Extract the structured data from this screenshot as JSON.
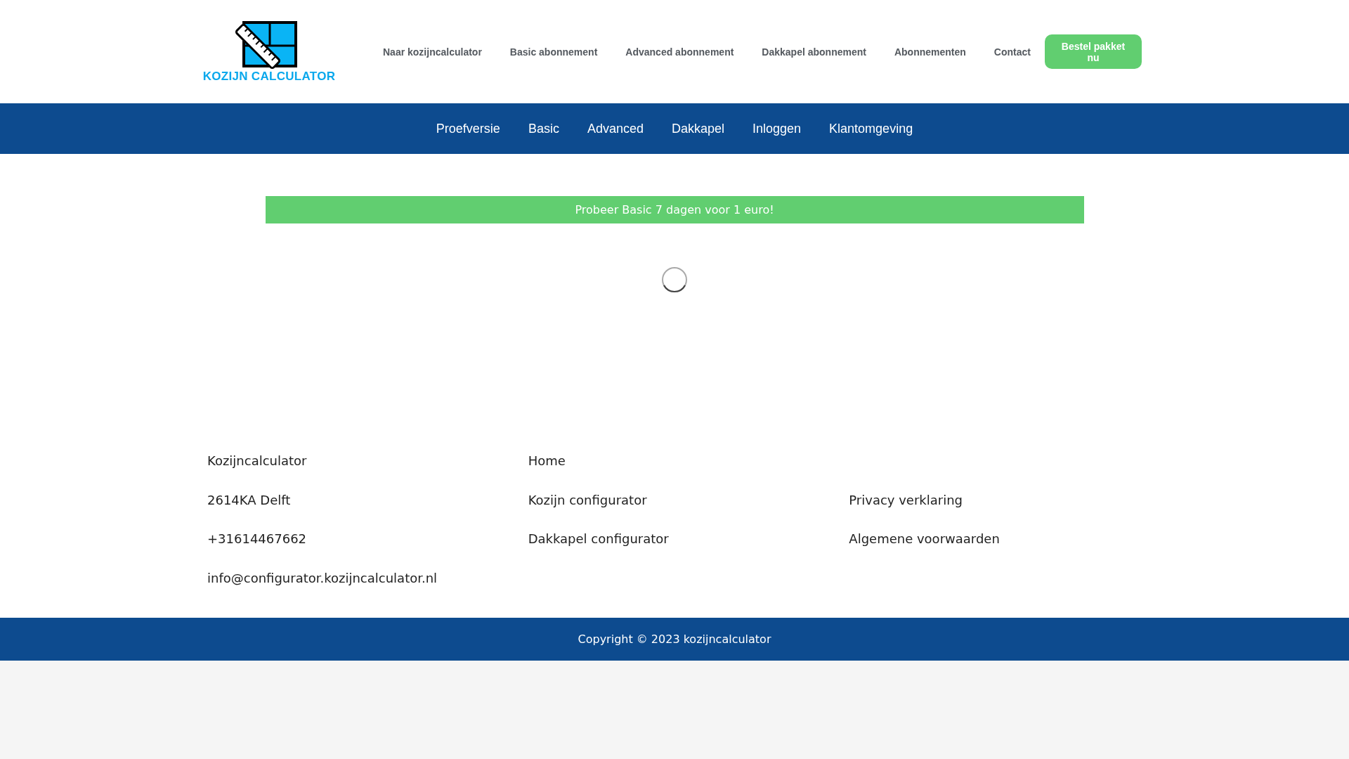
{
  "header": {
    "logo_text": "KOZIJN CALCULATOR",
    "nav": [
      {
        "label": "Naar kozijncalculator"
      },
      {
        "label": "Basic abonnement"
      },
      {
        "label": "Advanced abonnement"
      },
      {
        "label": "Dakkapel abonnement"
      },
      {
        "label": "Abonnementen"
      },
      {
        "label": "Contact"
      }
    ],
    "cta": "Bestel pakket nu"
  },
  "subnav": [
    {
      "label": "Proefversie"
    },
    {
      "label": "Basic"
    },
    {
      "label": "Advanced"
    },
    {
      "label": "Dakkapel"
    },
    {
      "label": "Inloggen"
    },
    {
      "label": "Klantomgeving"
    }
  ],
  "banner": "Probeer Basic 7 dagen voor 1 euro!",
  "footer": {
    "columns": [
      {
        "kind": "text",
        "items": [
          "Kozijncalculator",
          "2614KA Delft",
          "+31614467662",
          "info@configurator.kozijncalculator.nl"
        ]
      },
      {
        "kind": "links",
        "items": [
          "Home",
          "Kozijn configurator",
          "Dakkapel configurator"
        ]
      },
      {
        "kind": "links-offset",
        "items": [
          "Privacy verklaring",
          "Algemene voorwaarden"
        ]
      }
    ],
    "copyright": "Copyright © 2023 kozijncalculator"
  }
}
